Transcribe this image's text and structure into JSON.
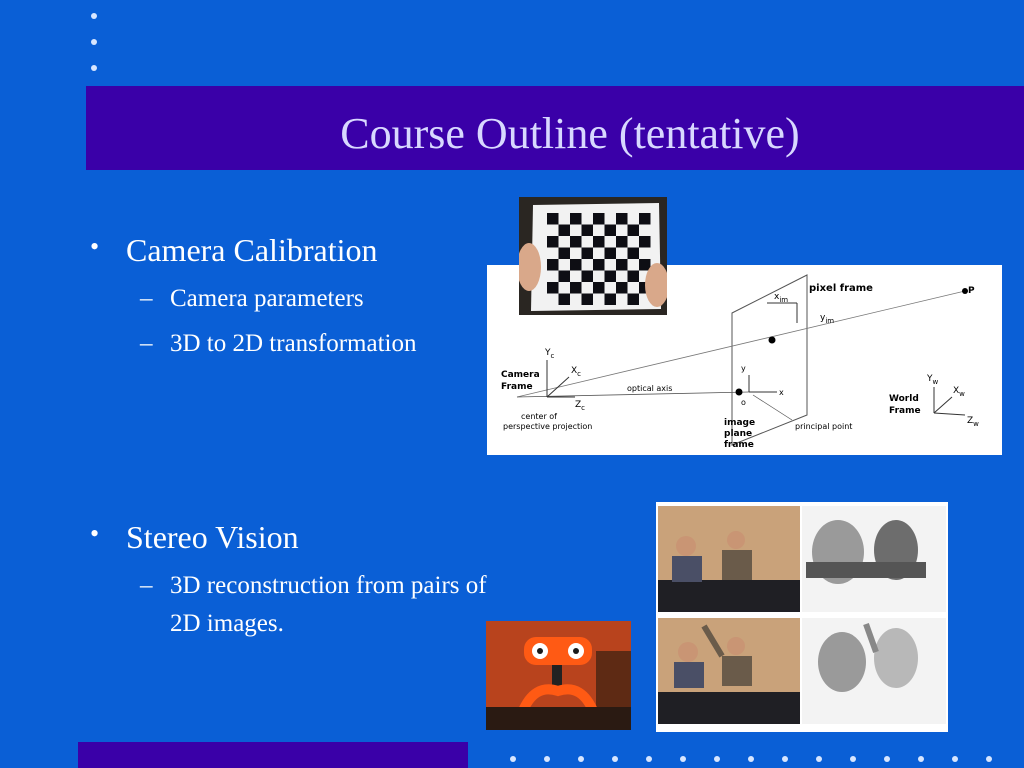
{
  "slide": {
    "title": "Course Outline (tentative)"
  },
  "content": {
    "bullets": [
      {
        "text": "Camera Calibration",
        "subitems": [
          "Camera parameters",
          "3D to 2D transformation"
        ]
      },
      {
        "text": "Stereo Vision",
        "subitems_lines": [
          "3D reconstruction from pairs of",
          "2D images."
        ]
      }
    ]
  },
  "diagram": {
    "pixel_frame": "pixel frame",
    "p_label": "P",
    "x_im": "x",
    "x_im_sub": "im",
    "y_im": "y",
    "y_im_sub": "im",
    "camera_frame_1": "Camera",
    "camera_frame_2": "Frame",
    "y_c": "Y",
    "y_c_sub": "c",
    "x_c": "X",
    "x_c_sub": "c",
    "z_c": "Z",
    "z_c_sub": "c",
    "optical_axis": "optical axis",
    "center_1": "center of",
    "center_2": "perspective projection",
    "y_small": "y",
    "x_small": "x",
    "o_label": "o",
    "image_plane_1": "image",
    "image_plane_2": "plane",
    "image_plane_3": "frame",
    "principal_point": "principal point",
    "world_frame_1": "World",
    "world_frame_2": "Frame",
    "y_w": "Y",
    "y_w_sub": "w",
    "x_w": "X",
    "x_w_sub": "w",
    "z_w": "Z",
    "z_w_sub": "w"
  },
  "colors": {
    "background": "#0a5fd6",
    "title_band": "#3a00a8",
    "title_text": "#d8d8ff"
  }
}
